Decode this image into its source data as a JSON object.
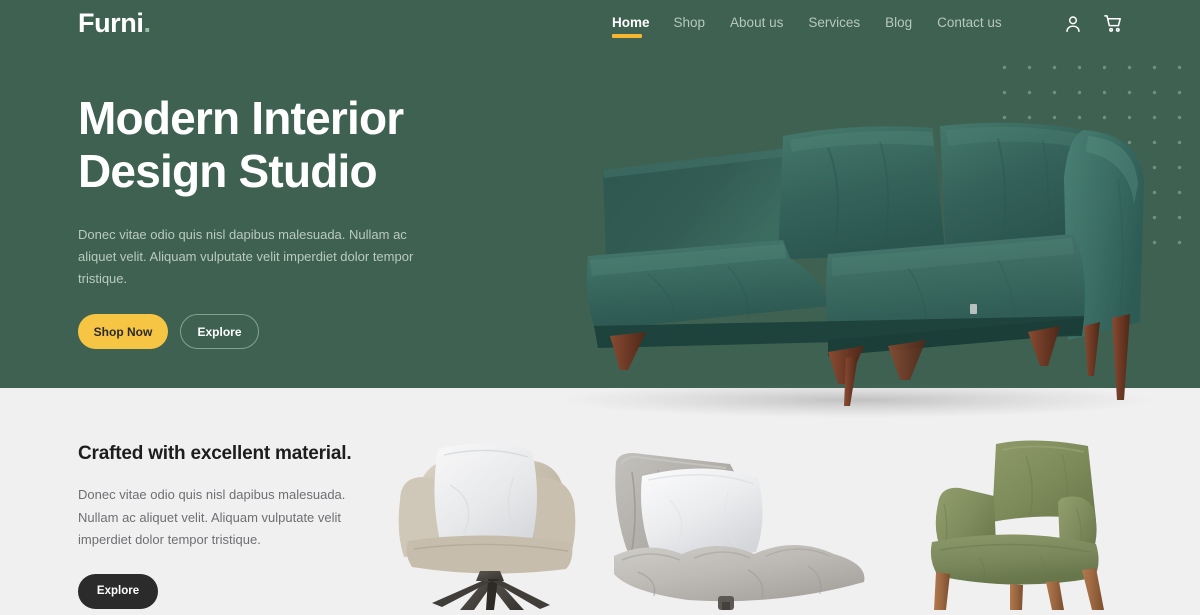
{
  "brand": {
    "name": "Furni",
    "dot": "."
  },
  "nav": {
    "items": [
      {
        "label": "Home",
        "active": true
      },
      {
        "label": "Shop",
        "active": false
      },
      {
        "label": "About us",
        "active": false
      },
      {
        "label": "Services",
        "active": false
      },
      {
        "label": "Blog",
        "active": false
      },
      {
        "label": "Contact us",
        "active": false
      }
    ],
    "icons": [
      {
        "name": "user-icon"
      },
      {
        "name": "cart-icon"
      }
    ]
  },
  "hero": {
    "title_line1": "Modern Interior",
    "title_line2": "Design Studio",
    "paragraph": "Donec vitae odio quis nisl dapibus malesuada. Nullam ac aliquet velit. Aliquam vulputate velit imperdiet dolor tempor tristique.",
    "primary_button": "Shop Now",
    "secondary_button": "Explore",
    "image_alt": "green-velvet-sofa"
  },
  "feature": {
    "title": "Crafted with excellent material.",
    "paragraph": "Donec vitae odio quis nisl dapibus malesuada. Nullam ac aliquet velit. Aliquam vulputate velit imperdiet dolor tempor tristique.",
    "button": "Explore",
    "products": [
      {
        "alt": "cream-armchair-with-white-pillow"
      },
      {
        "alt": "gray-padded-lounge-chair"
      },
      {
        "alt": "olive-green-wooden-leg-armchair"
      }
    ]
  },
  "colors": {
    "hero_background": "#3f6152",
    "accent_yellow": "#f7c544",
    "nav_underline": "#f5b731",
    "section_background": "#f0f0f1",
    "dark_button": "#2b2b2b"
  }
}
